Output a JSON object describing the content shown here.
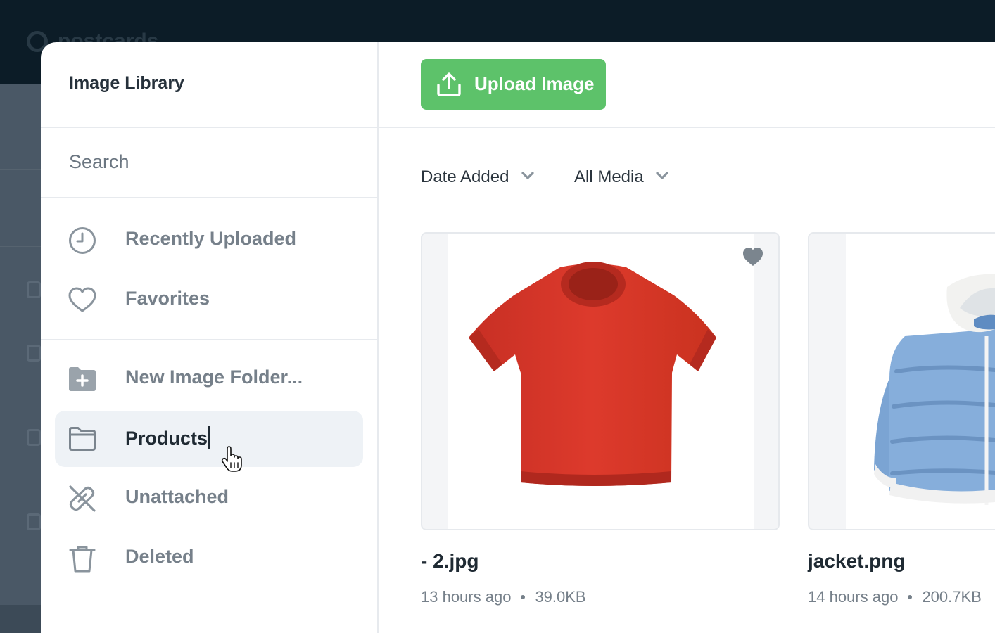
{
  "background": {
    "logo_text": "postcards"
  },
  "modal": {
    "title": "Image Library",
    "search": {
      "placeholder": "Search",
      "value": ""
    },
    "nav": [
      {
        "label": "Recently Uploaded",
        "icon": "clock-icon"
      },
      {
        "label": "Favorites",
        "icon": "heart-icon"
      },
      {
        "label": "New Image Folder...",
        "icon": "folder-plus-icon"
      },
      {
        "label": "Products",
        "icon": "folder-icon",
        "editing": true
      },
      {
        "label": "Unattached",
        "icon": "unlink-icon"
      },
      {
        "label": "Deleted",
        "icon": "trash-icon"
      }
    ],
    "upload_button": {
      "label": "Upload Image",
      "icon": "upload-icon"
    },
    "filters": [
      {
        "label": "Date Added",
        "icon": "chevron-down-icon"
      },
      {
        "label": "All Media",
        "icon": "chevron-down-icon"
      }
    ],
    "images": [
      {
        "name": "- 2.jpg",
        "time": "13 hours ago",
        "size": "39.0KB",
        "favorite": true
      },
      {
        "name": "jacket.png",
        "time": "14 hours ago",
        "size": "200.7KB",
        "favorite": false
      }
    ]
  },
  "colors": {
    "accent_green": "#5dc26a",
    "dark_header": "#0c1c27",
    "tshirt_red": "#d8382c",
    "jacket_blue": "#7ea7d6"
  }
}
